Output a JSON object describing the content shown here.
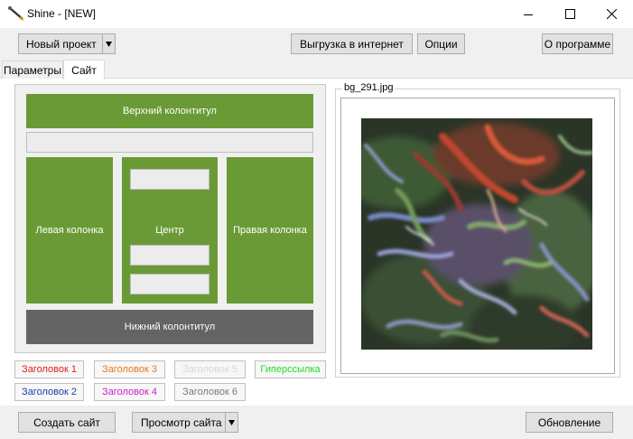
{
  "window": {
    "title": "Shine - [NEW]"
  },
  "toolbar": {
    "new_project_label": "Новый проект",
    "upload_label": "Выгрузка в интернет",
    "options_label": "Опции",
    "about_label": "О программе"
  },
  "tabs": [
    {
      "label": "Параметры",
      "active": false
    },
    {
      "label": "Сайт",
      "active": true
    }
  ],
  "layout": {
    "header_label": "Верхний колонтитул",
    "left_column_label": "Левая колонка",
    "center_label": "Центр",
    "right_column_label": "Правая колонка",
    "footer_label": "Нижний колонтитул",
    "accent_color": "#6a9a35",
    "footer_color": "#646464"
  },
  "headings": [
    {
      "label": "Заголовок 1",
      "color": "#e02020"
    },
    {
      "label": "Заголовок 2",
      "color": "#1f3fa8"
    },
    {
      "label": "Заголовок 3",
      "color": "#e87a1e"
    },
    {
      "label": "Заголовок 4",
      "color": "#d020c8"
    },
    {
      "label": "Заголовок 5",
      "color": "#d8d8d8"
    },
    {
      "label": "Заголовок 6",
      "color": "#7a7a7a"
    },
    {
      "label": "Гиперссылка",
      "color": "#22dd22"
    }
  ],
  "preview": {
    "filename": "bg_291.jpg"
  },
  "bottom": {
    "create_site_label": "Создать сайт",
    "view_site_label": "Просмотр сайта",
    "update_label": "Обновление"
  }
}
